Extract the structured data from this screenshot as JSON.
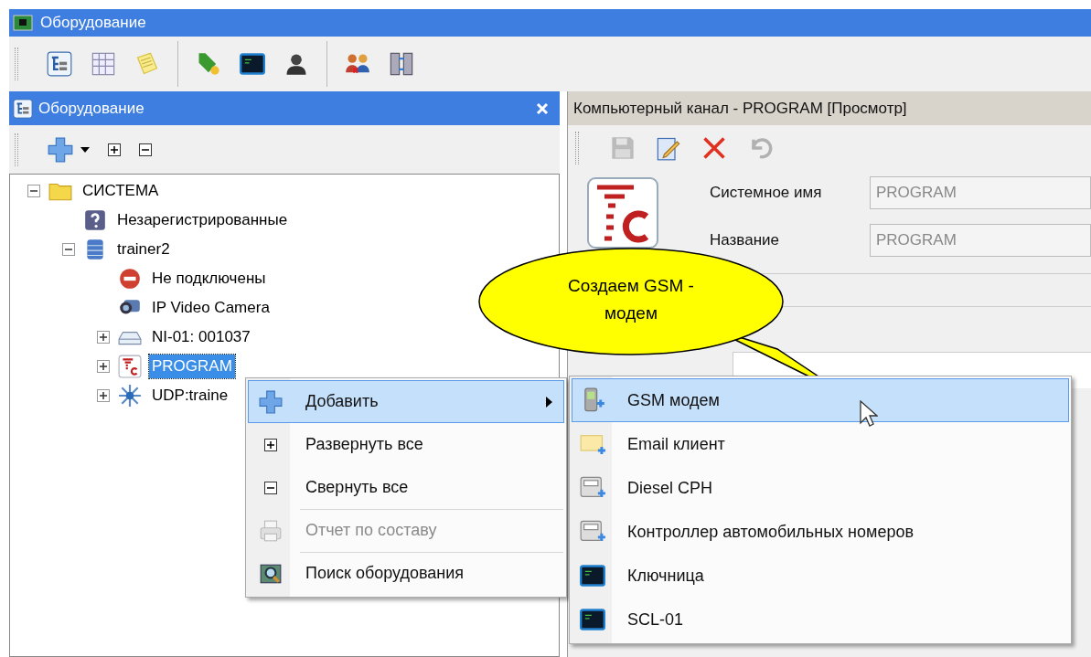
{
  "window": {
    "title": "Оборудование"
  },
  "main_toolbar": [
    {
      "kind": "tree"
    },
    {
      "kind": "grid"
    },
    {
      "kind": "notes"
    },
    {
      "kind": "separator"
    },
    {
      "kind": "tag"
    },
    {
      "kind": "terminal"
    },
    {
      "kind": "person"
    },
    {
      "kind": "separator"
    },
    {
      "kind": "users"
    },
    {
      "kind": "sync"
    }
  ],
  "left_panel": {
    "title": "Оборудование",
    "toolbar": [
      {
        "kind": "add"
      },
      {
        "kind": "expand"
      },
      {
        "kind": "collapse"
      }
    ],
    "tree": [
      {
        "label": "СИСТЕМА",
        "kind": "folder",
        "expanded": true,
        "selected": false,
        "children": [
          {
            "label": "Незарегистрированные",
            "kind": "unknown",
            "selected": false
          },
          {
            "label": "trainer2",
            "kind": "server",
            "expanded": true,
            "selected": false,
            "children": [
              {
                "label": "Не подключены",
                "kind": "blocked",
                "selected": false
              },
              {
                "label": "IP Video Camera",
                "kind": "camera",
                "selected": false
              },
              {
                "label": "NI-01: 001037",
                "kind": "device",
                "expanded": false,
                "selected": false
              },
              {
                "label": "PROGRAM",
                "kind": "program",
                "expanded": false,
                "selected": true
              },
              {
                "label": "UDP:traine",
                "kind": "network",
                "expanded": false,
                "selected": false
              }
            ]
          }
        ]
      }
    ]
  },
  "right_panel": {
    "title": "Компьютерный канал - PROGRAM [Просмотр]",
    "toolbar": [
      {
        "kind": "save",
        "disabled": true
      },
      {
        "kind": "edit",
        "disabled": false
      },
      {
        "kind": "delete",
        "disabled": false
      },
      {
        "kind": "undo",
        "disabled": true
      }
    ],
    "fields": [
      {
        "label": "Системное имя",
        "value": "PROGRAM",
        "disabled": true
      },
      {
        "label": "Название",
        "value": "PROGRAM",
        "disabled": true
      }
    ]
  },
  "context_menu": [
    {
      "label": "Добавить",
      "kind": "add",
      "selected": true,
      "disabled": false,
      "submenu": true,
      "divider_above": false
    },
    {
      "label": "Развернуть все",
      "kind": "expand",
      "selected": false,
      "disabled": false,
      "submenu": false,
      "divider_above": false
    },
    {
      "label": "Свернуть все",
      "kind": "collapse",
      "selected": false,
      "disabled": false,
      "submenu": false,
      "divider_above": false
    },
    {
      "label": "Отчет по составу",
      "kind": "report",
      "selected": false,
      "disabled": true,
      "submenu": false,
      "divider_above": true
    },
    {
      "label": "Поиск оборудования",
      "kind": "search",
      "selected": false,
      "disabled": false,
      "submenu": false,
      "divider_above": true
    }
  ],
  "submenu": [
    {
      "label": "GSM модем",
      "kind": "phone",
      "selected": true
    },
    {
      "label": "Email клиент",
      "kind": "mail",
      "selected": false
    },
    {
      "label": "Diesel CPH",
      "kind": "display",
      "selected": false
    },
    {
      "label": "Контроллер автомобильных номеров",
      "kind": "display",
      "selected": false
    },
    {
      "label": "Ключница",
      "kind": "terminal",
      "selected": false
    },
    {
      "label": "SCL-01",
      "kind": "terminal",
      "selected": false
    }
  ],
  "callout": {
    "text": "Создаем GSM -\nмодем"
  }
}
